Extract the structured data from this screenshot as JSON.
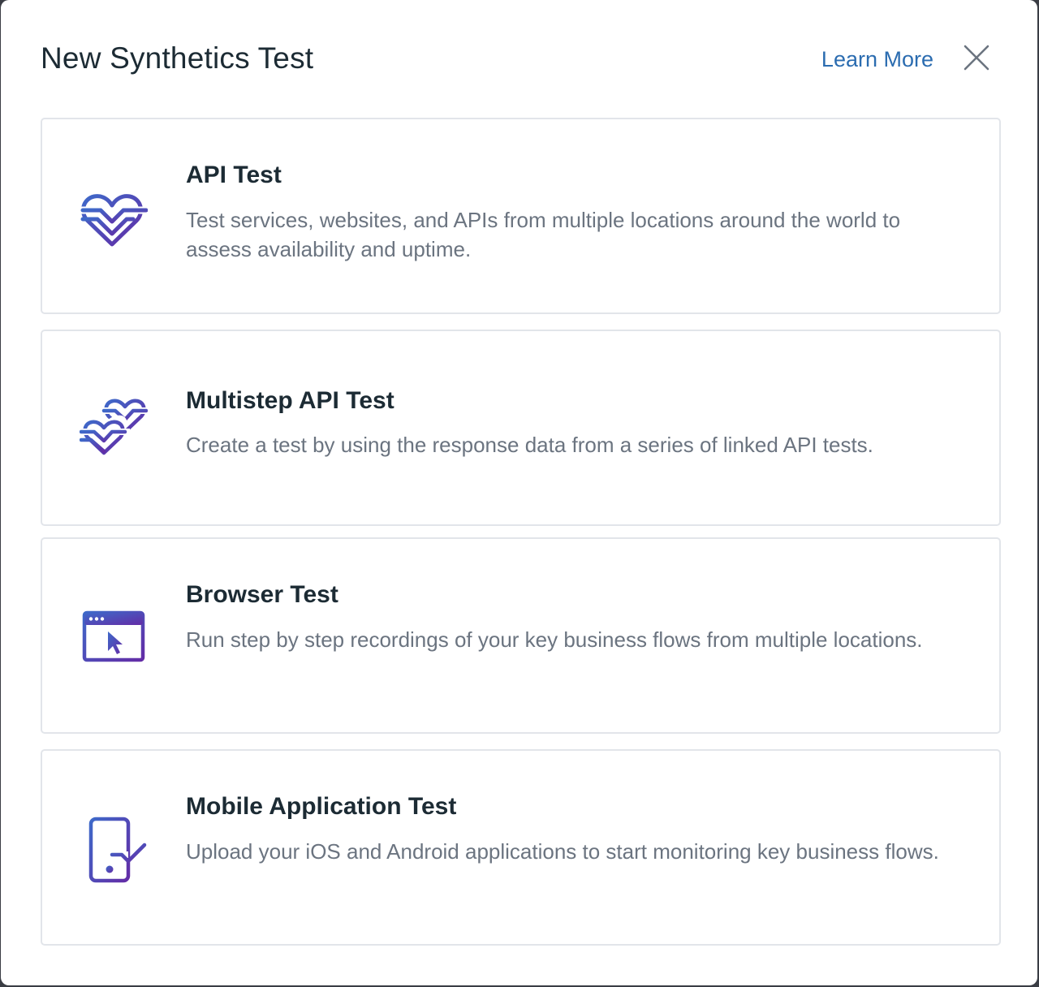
{
  "modal": {
    "title": "New Synthetics Test",
    "learn_more_label": "Learn More"
  },
  "accent_colors": {
    "icon_gradient_start": "#3e69c9",
    "icon_gradient_end": "#632ca6",
    "link": "#2b6cb0"
  },
  "test_types": [
    {
      "icon": "heartbeat-icon",
      "title": "API Test",
      "description": "Test services, websites, and APIs from multiple locations around the world to assess availability and uptime."
    },
    {
      "icon": "double-heartbeat-icon",
      "title": "Multistep API Test",
      "description": "Create a test by using the response data from a series of linked API tests."
    },
    {
      "icon": "browser-window-cursor-icon",
      "title": "Browser Test",
      "description": "Run step by step recordings of your key business flows from multiple locations."
    },
    {
      "icon": "mobile-phone-check-icon",
      "title": "Mobile Application Test",
      "description": "Upload your iOS and Android applications to start monitoring key business flows."
    }
  ]
}
